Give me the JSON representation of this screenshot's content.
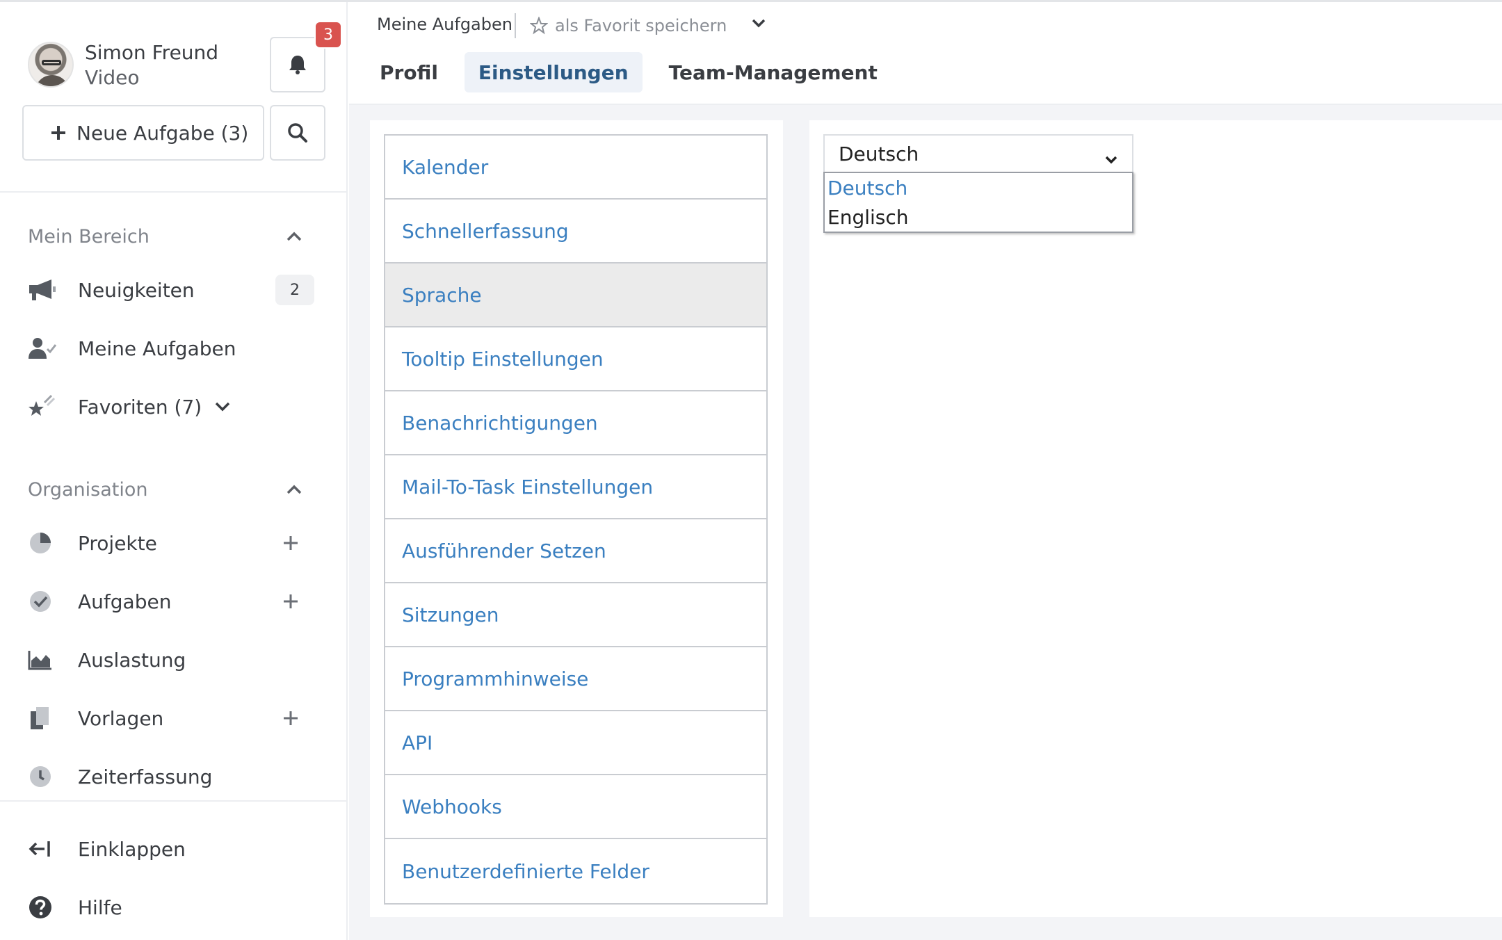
{
  "user": {
    "name": "Simon Freund",
    "role": "Video"
  },
  "notifications": {
    "count": "3"
  },
  "new_task": {
    "label": "Neue Aufgabe (3)"
  },
  "sections": {
    "mein_bereich": {
      "title": "Mein Bereich",
      "items": [
        {
          "label": "Neuigkeiten",
          "icon": "megaphone-icon",
          "badge": "2"
        },
        {
          "label": "Meine Aufgaben",
          "icon": "user-check-icon"
        },
        {
          "label": "Favoriten (7)",
          "icon": "star-icon"
        }
      ]
    },
    "organisation": {
      "title": "Organisation",
      "items": [
        {
          "label": "Projekte",
          "icon": "pie-chart-icon"
        },
        {
          "label": "Aufgaben",
          "icon": "check-circle-icon"
        },
        {
          "label": "Auslastung",
          "icon": "area-chart-icon"
        },
        {
          "label": "Vorlagen",
          "icon": "documents-icon"
        },
        {
          "label": "Zeiterfassung",
          "icon": "clock-icon"
        }
      ]
    }
  },
  "footer": {
    "collapse": "Einklappen",
    "help": "Hilfe"
  },
  "header": {
    "breadcrumb": "Meine Aufgaben",
    "favorite": "als Favorit speichern",
    "tabs": [
      {
        "label": "Profil"
      },
      {
        "label": "Einstellungen",
        "active": true
      },
      {
        "label": "Team-Management"
      }
    ]
  },
  "settings": {
    "items": [
      "Kalender",
      "Schnellerfassung",
      "Sprache",
      "Tooltip Einstellungen",
      "Benachrichtigungen",
      "Mail-To-Task Einstellungen",
      "Ausführender Setzen",
      "Sitzungen",
      "Programmhinweise",
      "API",
      "Webhooks",
      "Benutzerdefinierte Felder"
    ],
    "active": "Sprache"
  },
  "language": {
    "selected": "Deutsch",
    "options": [
      "Deutsch",
      "Englisch"
    ]
  },
  "colors": {
    "link": "#3a7fc0",
    "tab_active_bg": "#eef2f8",
    "badge_red": "#d9534f",
    "content_bg": "#f3f4f7"
  }
}
